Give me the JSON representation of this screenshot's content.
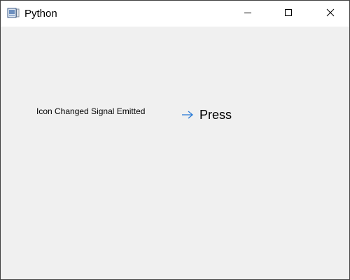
{
  "window": {
    "title": "Python"
  },
  "titlebar": {
    "app_icon": "python-window-icon",
    "minimize_icon": "minimize-icon",
    "maximize_icon": "maximize-icon",
    "close_icon": "close-icon"
  },
  "content": {
    "label_text": "Icon Changed Signal Emitted",
    "button": {
      "label": "Press",
      "icon": "arrow-right-icon",
      "icon_color": "#2b7bd6"
    }
  },
  "colors": {
    "titlebar_bg": "#ffffff",
    "client_bg": "#f0f0f0",
    "border": "#3f3f3f"
  }
}
